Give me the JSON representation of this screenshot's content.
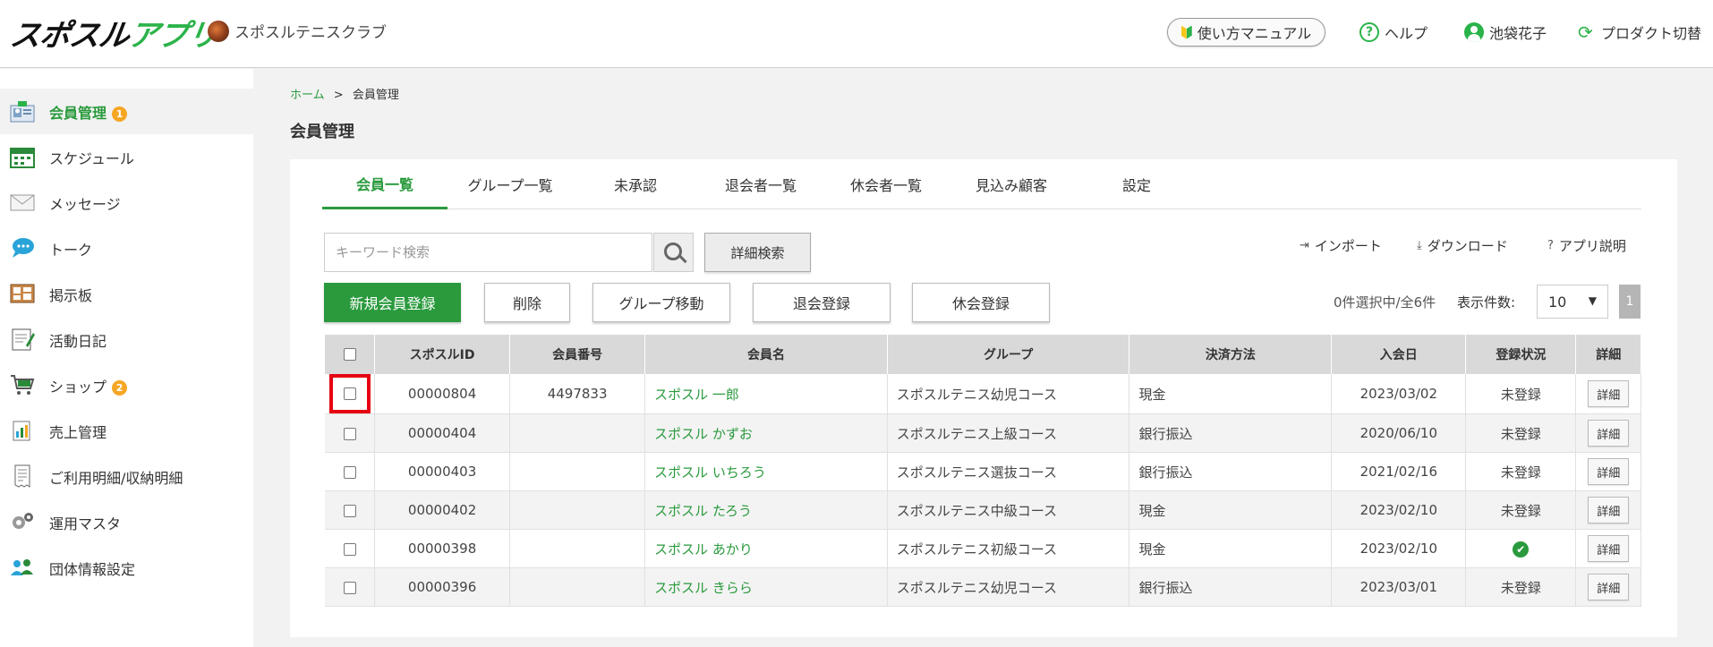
{
  "header": {
    "logo_black": "スポスル",
    "logo_green": "アプリ",
    "club_name": "スポスルテニスクラブ",
    "manual_label": "使い方マニュアル",
    "help_label": "ヘルプ",
    "user_name": "池袋花子",
    "switch_label": "プロダクト切替"
  },
  "sidebar": {
    "items": [
      {
        "label": "会員管理",
        "badge": "1",
        "icon": "members-icon"
      },
      {
        "label": "スケジュール",
        "icon": "calendar-icon"
      },
      {
        "label": "メッセージ",
        "icon": "mail-icon"
      },
      {
        "label": "トーク",
        "icon": "chat-icon"
      },
      {
        "label": "掲示板",
        "icon": "board-icon"
      },
      {
        "label": "活動日記",
        "icon": "diary-icon"
      },
      {
        "label": "ショップ",
        "badge": "2",
        "icon": "cart-icon"
      },
      {
        "label": "売上管理",
        "icon": "sales-icon"
      },
      {
        "label": "ご利用明細/収納明細",
        "icon": "receipt-icon"
      },
      {
        "label": "運用マスタ",
        "icon": "gears-icon"
      },
      {
        "label": "団体情報設定",
        "icon": "group-settings-icon"
      }
    ]
  },
  "breadcrumb": {
    "home": "ホーム",
    "sep": ">",
    "current": "会員管理"
  },
  "page_title": "会員管理",
  "tabs": [
    "会員一覧",
    "グループ一覧",
    "未承認",
    "退会者一覧",
    "休会者一覧",
    "見込み顧客",
    "設定"
  ],
  "search": {
    "placeholder": "キーワード検索",
    "advanced_label": "詳細検索"
  },
  "links": {
    "import": "インポート",
    "download": "ダウンロード",
    "app_help": "アプリ説明"
  },
  "actions": {
    "new": "新規会員登録",
    "delete": "削除",
    "group_move": "グループ移動",
    "withdraw": "退会登録",
    "suspend": "休会登録"
  },
  "selection": {
    "count_text": "0件選択中/全6件",
    "per_page_label": "表示件数:",
    "per_page_value": "10",
    "page": "1"
  },
  "table": {
    "headers": [
      "スポスルID",
      "会員番号",
      "会員名",
      "グループ",
      "決済方法",
      "入会日",
      "登録状況",
      "詳細"
    ],
    "detail_label": "詳細",
    "rows": [
      {
        "id": "00000804",
        "number": "4497833",
        "name": "スポスル 一郎",
        "group": "スポスルテニス幼児コース",
        "payment": "現金",
        "joined": "2023/03/02",
        "status": "未登録"
      },
      {
        "id": "00000404",
        "number": "",
        "name": "スポスル かずお",
        "group": "スポスルテニス上級コース",
        "payment": "銀行振込",
        "joined": "2020/06/10",
        "status": "未登録"
      },
      {
        "id": "00000403",
        "number": "",
        "name": "スポスル いちろう",
        "group": "スポスルテニス選抜コース",
        "payment": "銀行振込",
        "joined": "2021/02/16",
        "status": "未登録"
      },
      {
        "id": "00000402",
        "number": "",
        "name": "スポスル たろう",
        "group": "スポスルテニス中級コース",
        "payment": "現金",
        "joined": "2023/02/10",
        "status": "未登録"
      },
      {
        "id": "00000398",
        "number": "",
        "name": "スポスル あかり",
        "group": "スポスルテニス初級コース",
        "payment": "現金",
        "joined": "2023/02/10",
        "status": "✔"
      },
      {
        "id": "00000396",
        "number": "",
        "name": "スポスル きらら",
        "group": "スポスルテニス幼児コース",
        "payment": "銀行振込",
        "joined": "2023/03/01",
        "status": "未登録"
      }
    ]
  }
}
